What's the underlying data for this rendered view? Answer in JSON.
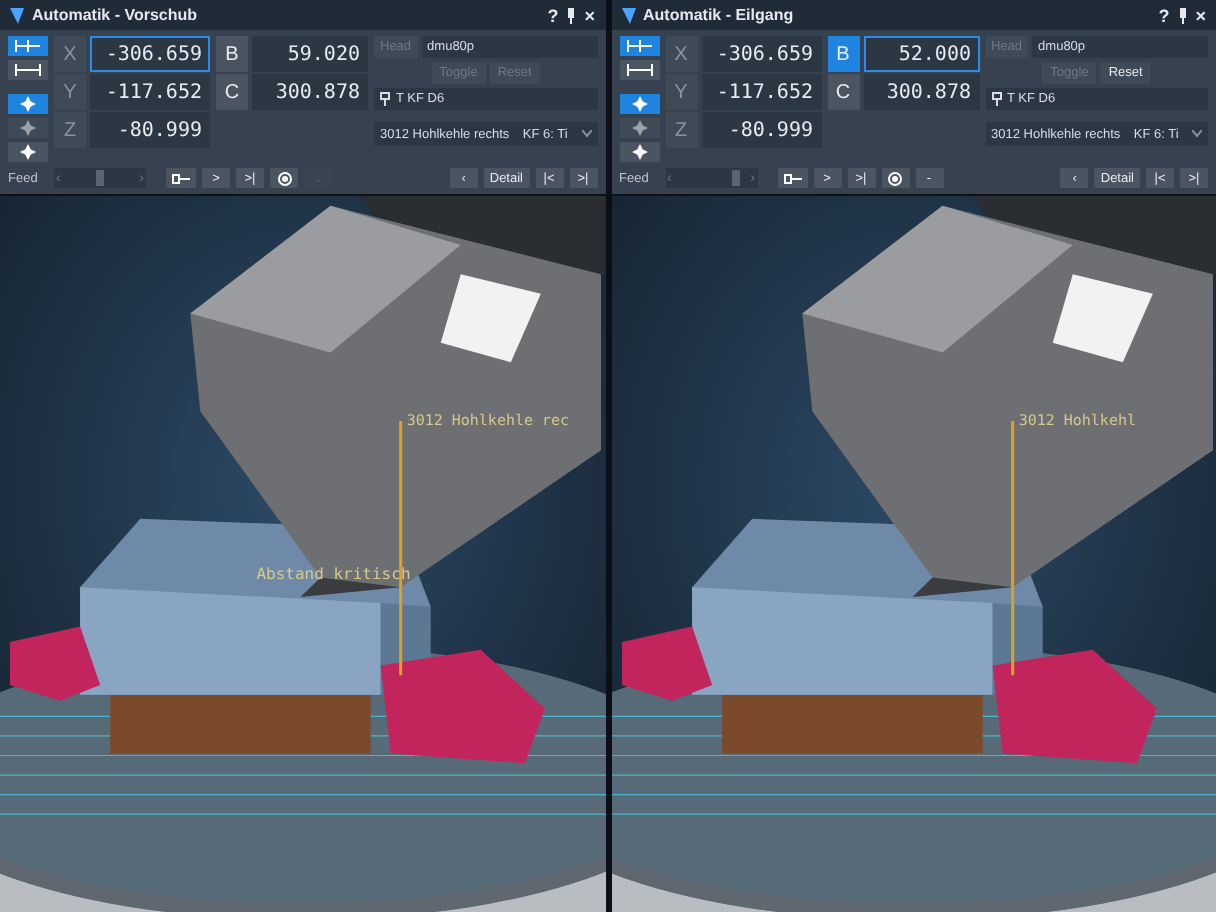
{
  "panes": [
    {
      "title": "Automatik - Vorschub",
      "help": "?",
      "close": "×",
      "mode_buttons": [
        {
          "selected": true
        },
        {
          "selected": false
        }
      ],
      "jog_buttons": [
        {
          "selected": true,
          "disabled": false
        },
        {
          "selected": false,
          "disabled": true
        },
        {
          "selected": false,
          "disabled": false
        }
      ],
      "axes": [
        {
          "label": "X",
          "value": "-306.659",
          "focused": true
        },
        {
          "label": "Y",
          "value": "-117.652",
          "focused": false
        },
        {
          "label": "Z",
          "value": "-80.999",
          "focused": false
        }
      ],
      "rotary_axes": [
        {
          "label": "B",
          "value": "59.020",
          "selected": false,
          "focused": false
        },
        {
          "label": "C",
          "value": "300.878",
          "selected": false,
          "focused": false
        }
      ],
      "head": {
        "label": "Head",
        "value": "dmu80p"
      },
      "toggle": {
        "label": "Toggle",
        "disabled": true
      },
      "reset": {
        "label": "Reset",
        "disabled": true
      },
      "tool": "T KF D6",
      "operation": "3012 Hohlkehle rechts",
      "operation_tool": "KF 6: Ti",
      "feed": {
        "label": "Feed",
        "prev": "‹",
        "next": "›",
        "level": 0.5
      },
      "controls": [
        {
          "kind": "key"
        },
        {
          "kind": "text",
          "text": ">"
        },
        {
          "kind": "text",
          "text": ">|"
        },
        {
          "kind": "record"
        },
        {
          "kind": "text",
          "text": ".",
          "disabled": true
        }
      ],
      "nav": {
        "back": "‹",
        "detail": "Detail",
        "first": "|<",
        "last": ">|"
      },
      "scene_labels": [
        {
          "kind": "operation",
          "text": "3012 Hohlkehle rec"
        },
        {
          "kind": "warning",
          "text": "Abstand kritisch"
        }
      ]
    },
    {
      "title": "Automatik - Eilgang",
      "help": "?",
      "close": "×",
      "mode_buttons": [
        {
          "selected": true
        },
        {
          "selected": false
        }
      ],
      "jog_buttons": [
        {
          "selected": true,
          "disabled": false
        },
        {
          "selected": false,
          "disabled": true
        },
        {
          "selected": false,
          "disabled": false
        }
      ],
      "axes": [
        {
          "label": "X",
          "value": "-306.659",
          "focused": false
        },
        {
          "label": "Y",
          "value": "-117.652",
          "focused": false
        },
        {
          "label": "Z",
          "value": "-80.999",
          "focused": false
        }
      ],
      "rotary_axes": [
        {
          "label": "B",
          "value": "52.000",
          "selected": true,
          "focused": true
        },
        {
          "label": "C",
          "value": "300.878",
          "selected": false,
          "focused": false
        }
      ],
      "head": {
        "label": "Head",
        "value": "dmu80p"
      },
      "toggle": {
        "label": "Toggle",
        "disabled": true
      },
      "reset": {
        "label": "Reset",
        "disabled": false
      },
      "tool": "T KF D6",
      "operation": "3012 Hohlkehle rechts",
      "operation_tool": "KF 6: Ti",
      "feed": {
        "label": "Feed",
        "prev": "‹",
        "next": "›",
        "level": 0.85
      },
      "controls": [
        {
          "kind": "key"
        },
        {
          "kind": "text",
          "text": ">"
        },
        {
          "kind": "text",
          "text": ">|"
        },
        {
          "kind": "record"
        },
        {
          "kind": "text",
          "text": "-",
          "disabled": false
        }
      ],
      "nav": {
        "back": "‹",
        "detail": "Detail",
        "first": "|<",
        "last": ">|"
      },
      "scene_labels": [
        {
          "kind": "operation",
          "text": "3012 Hohlkehl"
        }
      ]
    }
  ]
}
